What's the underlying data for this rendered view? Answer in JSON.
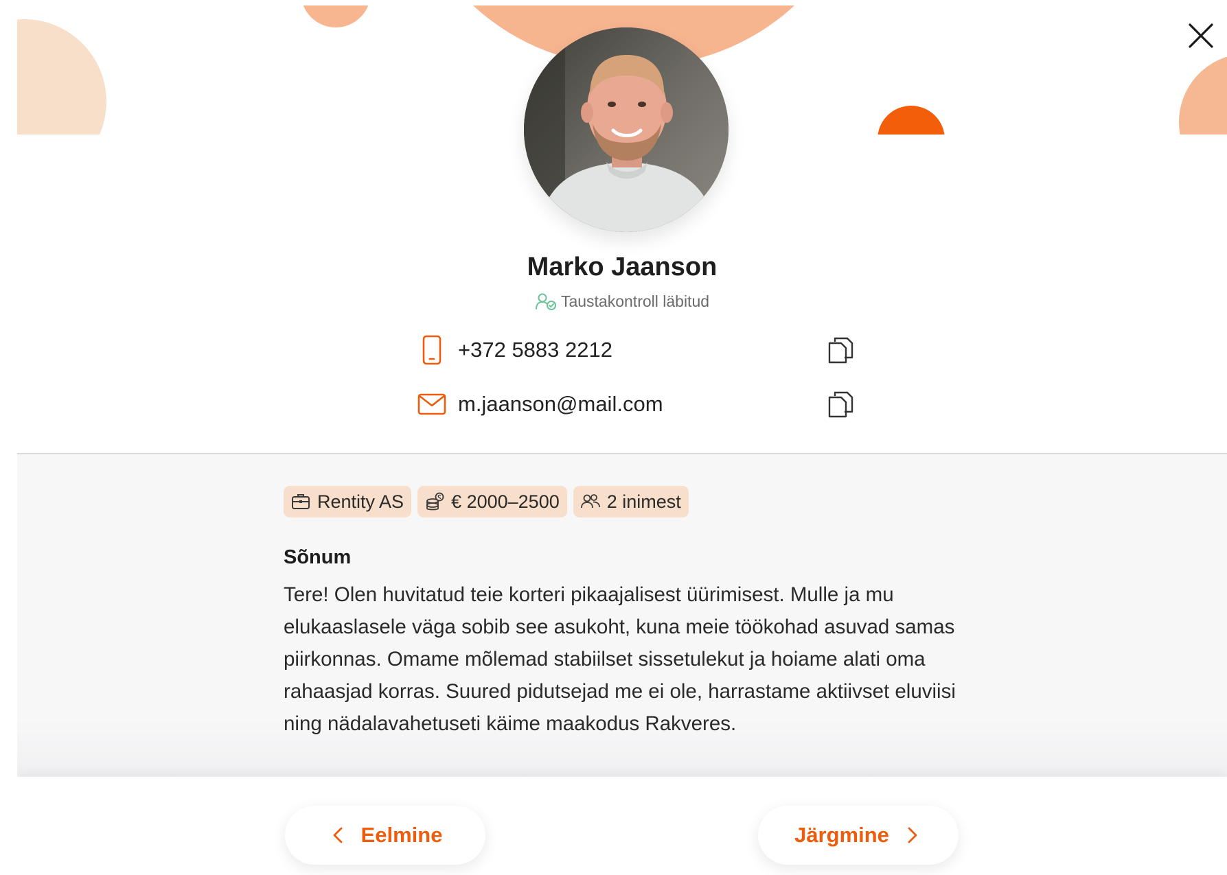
{
  "profile": {
    "name": "Marko Jaanson",
    "verification": "Taustakontroll läbitud"
  },
  "contacts": {
    "phone": "+372 5883 2212",
    "email": "m.jaanson@mail.com"
  },
  "chips": {
    "company": "Rentity AS",
    "budget": "€ 2000–2500",
    "people": "2 inimest"
  },
  "message": {
    "title": "Sõnum",
    "body": "Tere! Olen huvitatud teie korteri pikaajalisest üürimisest. Mulle ja mu elukaaslasele väga sobib see asukoht, kuna meie töökohad asuvad samas piirkonnas. Omame mõlemad stabiilset sissetulekut ja hoiame alati oma rahaasjad korras. Suured pidutsejad me ei ole, harrastame aktiivset eluviisi ning nädalavahetuseti käime maakodus Rakveres."
  },
  "navigation": {
    "prev_label": "Eelmine",
    "next_label": "Järgmine"
  },
  "icons": {
    "close": "close-icon",
    "verify": "person-check-icon",
    "phone": "phone-icon",
    "email": "envelope-icon",
    "copy": "copy-icon",
    "company": "briefcase-icon",
    "budget": "coins-icon",
    "people": "people-icon",
    "prev": "chevron-left-icon",
    "next": "chevron-right-icon"
  },
  "colors": {
    "accent": "#ec5d0d",
    "chip_bg": "#f7dfcc",
    "verify_green": "#6cc39a",
    "deco_peach": "#f6b48f",
    "deco_light": "#f8dfc9",
    "deco_orange": "#f25e0a"
  }
}
